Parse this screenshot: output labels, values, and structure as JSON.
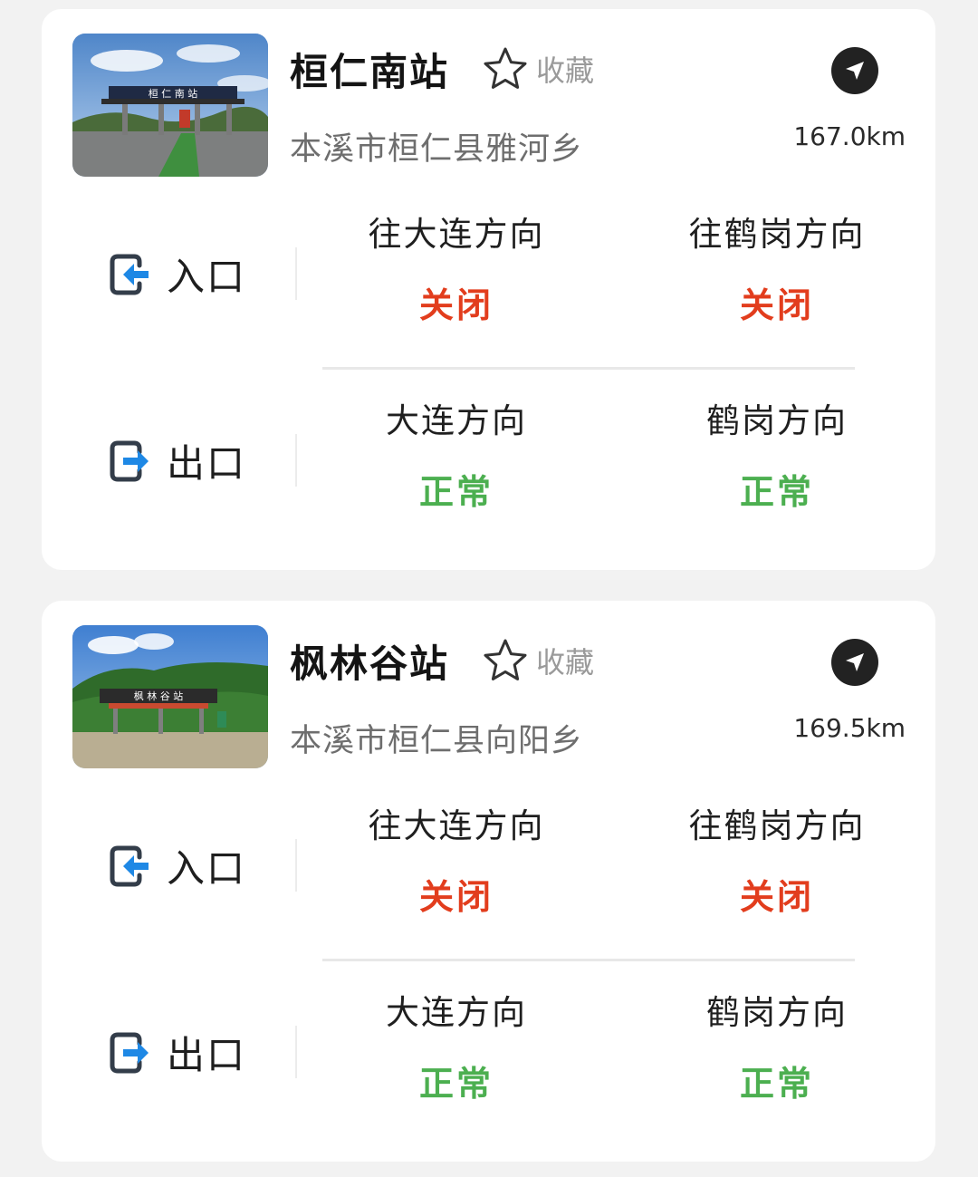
{
  "colors": {
    "closed": "#e23d1d",
    "open": "#4caf50",
    "entry_arrow": "#1e88e5"
  },
  "stations": [
    {
      "name": "桓仁南站",
      "favorite_label": "收藏",
      "address": "本溪市桓仁县雅河乡",
      "distance": "167.0km",
      "photo_sign": "桓 仁 南 站",
      "entry": {
        "label": "入口",
        "icon": "entrance-icon",
        "directions": [
          {
            "name": "往大连方向",
            "status": "关闭",
            "state": "closed"
          },
          {
            "name": "往鹤岗方向",
            "status": "关闭",
            "state": "closed"
          }
        ]
      },
      "exit": {
        "label": "出口",
        "icon": "exit-icon",
        "directions": [
          {
            "name": "大连方向",
            "status": "正常",
            "state": "open"
          },
          {
            "name": "鹤岗方向",
            "status": "正常",
            "state": "open"
          }
        ]
      }
    },
    {
      "name": "枫林谷站",
      "favorite_label": "收藏",
      "address": "本溪市桓仁县向阳乡",
      "distance": "169.5km",
      "photo_sign": "枫 林 谷 站",
      "entry": {
        "label": "入口",
        "icon": "entrance-icon",
        "directions": [
          {
            "name": "往大连方向",
            "status": "关闭",
            "state": "closed"
          },
          {
            "name": "往鹤岗方向",
            "status": "关闭",
            "state": "closed"
          }
        ]
      },
      "exit": {
        "label": "出口",
        "icon": "exit-icon",
        "directions": [
          {
            "name": "大连方向",
            "status": "正常",
            "state": "open"
          },
          {
            "name": "鹤岗方向",
            "status": "正常",
            "state": "open"
          }
        ]
      }
    }
  ]
}
